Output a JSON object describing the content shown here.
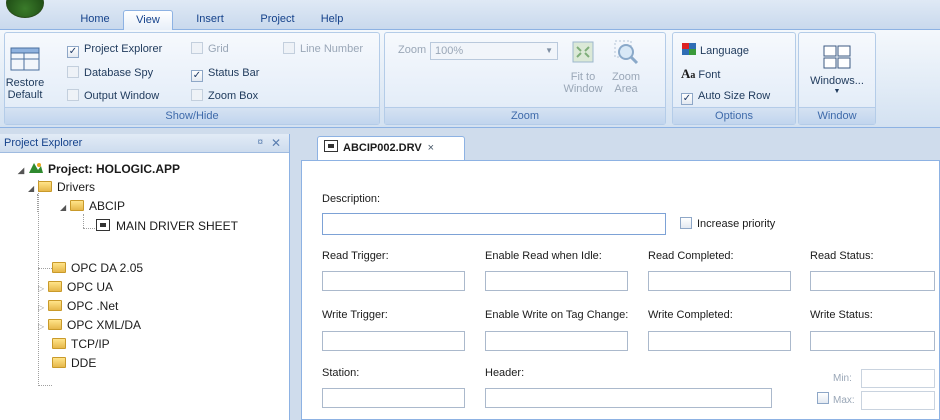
{
  "ribbon": {
    "tabs": [
      "Home",
      "View",
      "Insert",
      "Project",
      "Help"
    ],
    "active_tab": "View",
    "show_hide": {
      "label": "Show/Hide",
      "restore_default": "Restore Default",
      "restore_line1": "Restore",
      "restore_line2": "Default",
      "project_explorer": "Project Explorer",
      "database_spy": "Database Spy",
      "output_window": "Output Window",
      "grid": "Grid",
      "status_bar": "Status Bar",
      "zoom_box": "Zoom Box",
      "line_number": "Line Number"
    },
    "zoom": {
      "label": "Zoom",
      "zoom_text": "Zoom",
      "zoom_value": "100%",
      "fit_line1": "Fit to",
      "fit_line2": "Window",
      "area_line1": "Zoom",
      "area_line2": "Area"
    },
    "options": {
      "label": "Options",
      "language": "Language",
      "font": "Font",
      "auto_size_row": "Auto Size Row"
    },
    "window": {
      "label": "Window",
      "windows": "Windows..."
    }
  },
  "explorer": {
    "title": "Project Explorer",
    "pin": "¤",
    "close": "✕",
    "project": "Project: HOLOGIC.APP",
    "drivers": "Drivers",
    "abcip": "ABCIP",
    "main_sheet": "MAIN DRIVER SHEET",
    "opc_da": "OPC DA 2.05",
    "opc_ua": "OPC UA",
    "opc_net": "OPC .Net",
    "opc_xml": "OPC XML/DA",
    "tcpip": "TCP/IP",
    "dde": "DDE"
  },
  "document": {
    "tab_title": "ABCIP002.DRV",
    "tab_close": "×",
    "description": "Description:",
    "increase_priority": "Increase priority",
    "read_trigger": "Read Trigger:",
    "enable_read_idle": "Enable Read when Idle:",
    "read_completed": "Read Completed:",
    "read_status": "Read Status:",
    "write_trigger": "Write Trigger:",
    "enable_write_change": "Enable Write on Tag Change:",
    "write_completed": "Write Completed:",
    "write_status": "Write Status:",
    "station": "Station:",
    "header": "Header:",
    "min": "Min:",
    "max": "Max:"
  }
}
